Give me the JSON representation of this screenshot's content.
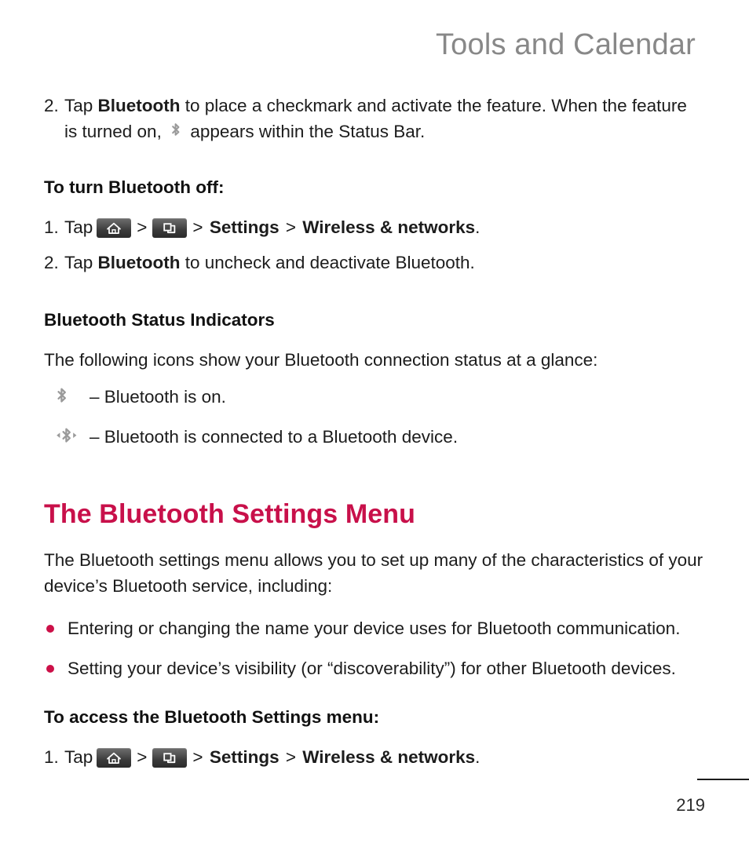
{
  "running_head": "Tools and Calendar",
  "steps_top": {
    "num": "2.",
    "part1": "Tap ",
    "bold1": "Bluetooth",
    "part2": " to place a checkmark and activate the feature. When the feature is turned on, ",
    "part3": " appears within the Status Bar."
  },
  "turn_off": {
    "heading": "To turn Bluetooth off:",
    "step1": {
      "num": "1.",
      "tap": "Tap",
      "sep1": ">",
      "sep2": ">",
      "settings": "Settings",
      "sep3": ">",
      "wireless": "Wireless & networks",
      "period": "."
    },
    "step2": {
      "num": "2.",
      "part1": "Tap ",
      "bold1": "Bluetooth",
      "part2": " to uncheck and deactivate Bluetooth."
    }
  },
  "status_indicators": {
    "heading": "Bluetooth Status Indicators",
    "intro": "The following icons show your Bluetooth connection status at a glance:",
    "rows": [
      {
        "icon": "bluetooth-on-icon",
        "text": "– Bluetooth is on."
      },
      {
        "icon": "bluetooth-connected-icon",
        "text": "– Bluetooth is connected to a Bluetooth device."
      }
    ]
  },
  "settings_menu": {
    "heading": "The Bluetooth Settings Menu",
    "paragraph": "The Bluetooth settings menu allows you to set up many of the characteristics of your device’s Bluetooth service, including:",
    "bullets": [
      "Entering or changing the name your device uses for Bluetooth communication.",
      "Setting your device’s visibility (or “discoverability”) for other Bluetooth devices."
    ],
    "access_heading": "To access the Bluetooth Settings menu:",
    "access_step": {
      "num": "1.",
      "tap": "Tap",
      "sep1": ">",
      "sep2": ">",
      "settings": "Settings",
      "sep3": ">",
      "wireless": "Wireless & networks",
      "period": "."
    }
  },
  "icons": {
    "home": "home-key-icon",
    "menu": "menu-key-icon"
  },
  "footer": {
    "page_number": "219"
  },
  "colors": {
    "heading_accent": "#c8104a",
    "bullet": "#cc1048",
    "running_head": "#888888",
    "body": "#1c1c1c"
  }
}
